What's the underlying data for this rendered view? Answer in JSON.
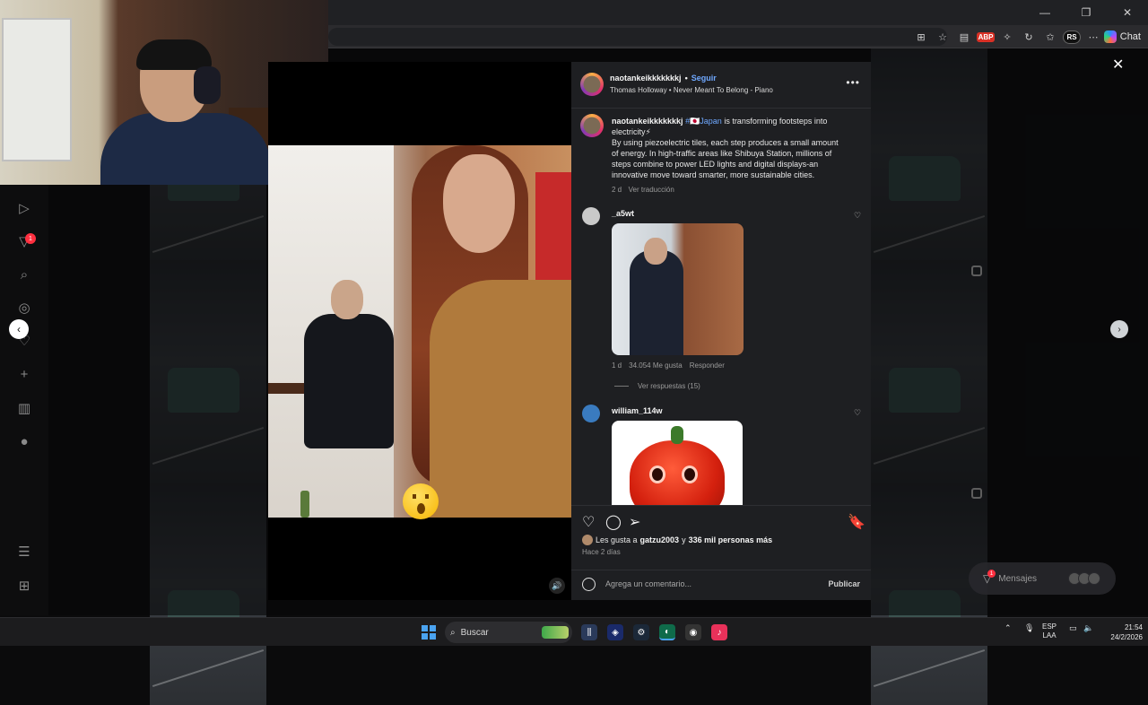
{
  "browser": {
    "chat_label": "Chat",
    "abp_label": "ABP",
    "rs_label": "RS",
    "window_controls": [
      "—",
      "❐",
      "✕"
    ]
  },
  "post": {
    "author": "naotankeikkkkkkkj",
    "follow_label": "Seguir",
    "separator": "•",
    "music": "Thomas Holloway • Never Meant To Belong - Piano",
    "caption_author": "naotankeikkkkkkkj",
    "caption_hashtag": "#🇯🇵Japan",
    "caption_line1": " is transforming footsteps into electricity⚡",
    "caption_body": "By using piezoelectric tiles, each step produces a small amount of energy. In high-traffic areas like Shibuya Station, millions of steps combine to power LED lights and digital displays-an innovative move toward smarter, more sustainable cities.",
    "caption_age": "2 d",
    "translate_label": "Ver traducción"
  },
  "comments": [
    {
      "user": "_a5wt",
      "age": "1 d",
      "likes": "34.054 Me gusta",
      "reply_label": "Responder",
      "view_replies": "Ver respuestas (15)"
    },
    {
      "user": "william_114w"
    }
  ],
  "actions": {
    "likes_prefix": "Les gusta a ",
    "likes_user": "gatzu2003",
    "likes_middle": " y ",
    "likes_count": "336 mil personas más",
    "posted": "Hace 2 días",
    "comment_placeholder": "Agrega un comentario...",
    "publish_label": "Publicar"
  },
  "sidebar": {
    "notif_count": "1"
  },
  "messages": {
    "label": "Mensajes",
    "badge": "1"
  },
  "taskbar": {
    "search_label": "Buscar",
    "lang_top": "ESP",
    "lang_bottom": "LAA",
    "time": "21:54",
    "date": "24/2/2026"
  }
}
